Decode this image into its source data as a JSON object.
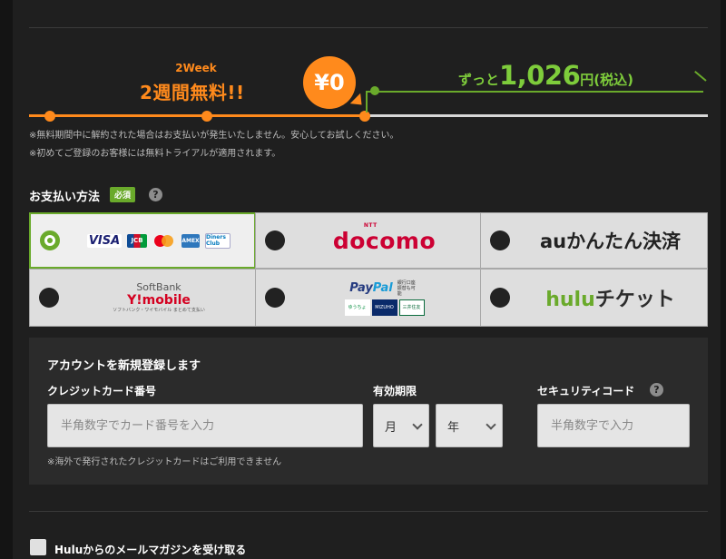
{
  "timeline": {
    "week_label": "2Week",
    "free_label": "2週間無料!!",
    "zero_price": "¥0",
    "after_prefix": "ずっと",
    "after_price": "1,026",
    "after_suffix": "円(税込)"
  },
  "notes": [
    "※無料期間中に解約された場合はお支払いが発生いたしません。安心してお試しください。",
    "※初めてご登録のお客様には無料トライアルが適用されます。"
  ],
  "payment": {
    "title": "お支払い方法",
    "required": "必須",
    "help": "?",
    "options": {
      "credit": {
        "visa": "VISA",
        "jcb": "JCB",
        "amex": "AMEX",
        "diners": "Diners Club"
      },
      "docomo": {
        "label": "docomo",
        "sup": "NTT"
      },
      "au": {
        "label_a": "au",
        "label_b": "かんたん決済"
      },
      "softbank": {
        "top": "SoftBank",
        "ym": "Y!mobile",
        "small": "ソフトバンク・ワイモバイル まとめて支払い"
      },
      "paypal": {
        "pay": "Pay",
        "pal": "Pal",
        "bank": "銀行口座 振替も可能",
        "b1": "ゆうちょ",
        "b2": "MIZUHO",
        "b3": "三井住友"
      },
      "hulu": {
        "label_a": "hulu",
        "label_b": "チケット"
      }
    },
    "selected": "credit"
  },
  "account": {
    "title": "アカウントを新規登録します",
    "card_label": "クレジットカード番号",
    "card_placeholder": "半角数字でカード番号を入力",
    "expiry_label": "有効期限",
    "month": "月",
    "year": "年",
    "security_label": "セキュリティコード",
    "security_help": "?",
    "security_placeholder": "半角数字で入力",
    "note": "※海外で発行されたクレジットカードはご利用できません"
  },
  "newsletter": {
    "label": "Huluからのメールマガジンを受け取る"
  },
  "colors": {
    "accent_orange": "#ff8a1c",
    "accent_green": "#6aaa2b",
    "docomo_red": "#cc0033"
  }
}
